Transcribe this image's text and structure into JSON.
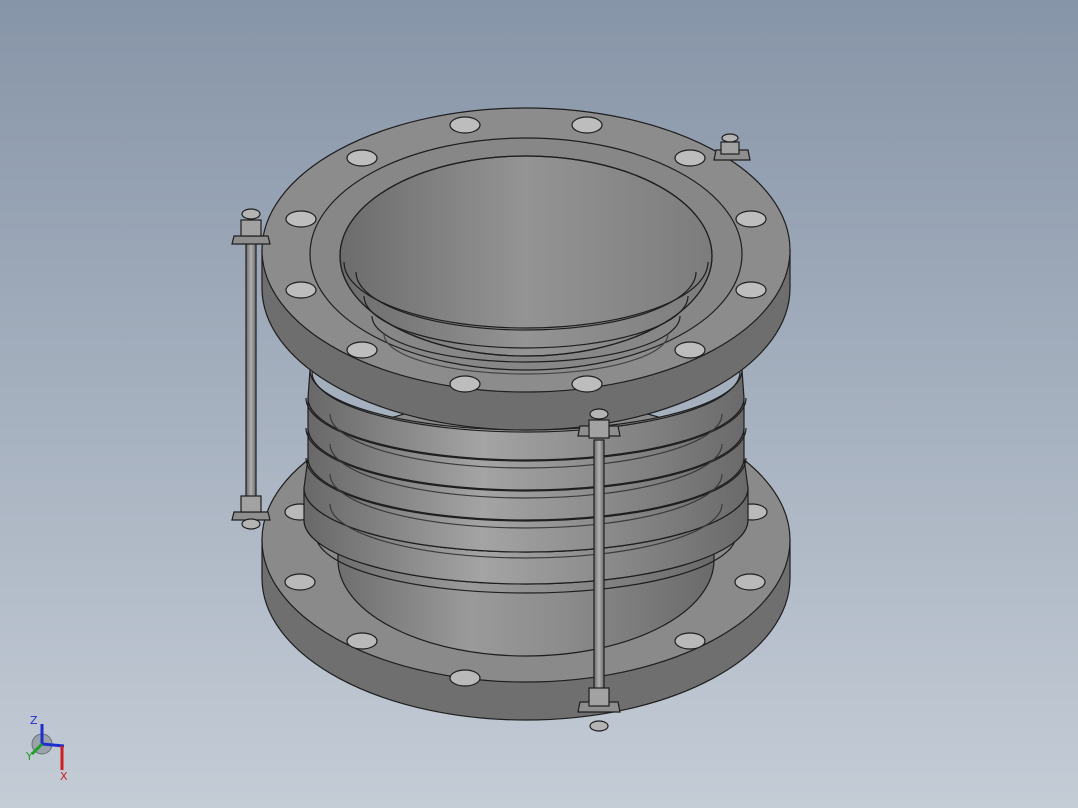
{
  "viewport": {
    "background_top": "#8795a8",
    "background_bottom": "#c4ccd6",
    "model_color": "#8a8a8a",
    "edge_color": "#1e1e1e"
  },
  "model": {
    "name": "bellows-expansion-joint",
    "flange_bolt_holes": 12,
    "bellows_convolutions": 5,
    "tie_rods": 3
  },
  "triad": {
    "x_label": "X",
    "y_label": "Y",
    "z_label": "Z",
    "x_color": "#cc1f1f",
    "y_color": "#1f9e2c",
    "z_color": "#1f2fcc"
  }
}
